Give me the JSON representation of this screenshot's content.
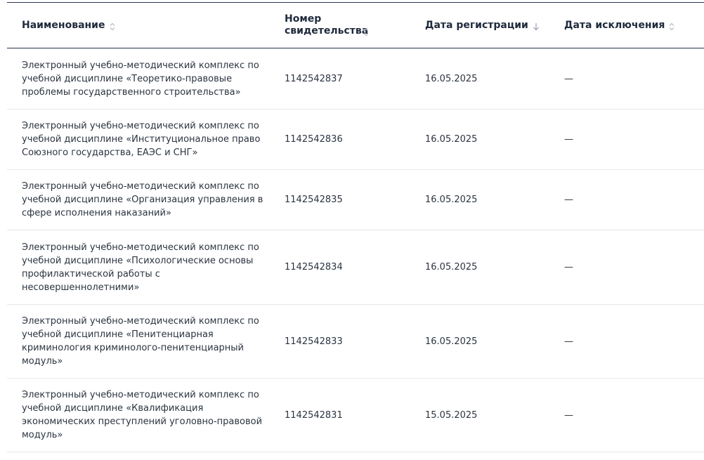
{
  "table": {
    "columns": [
      {
        "label": "Наименование",
        "sort": "none"
      },
      {
        "label": "Номер свидетельства",
        "sort": "none"
      },
      {
        "label": "Дата регистрации",
        "sort": "desc"
      },
      {
        "label": "Дата исключения",
        "sort": "none"
      }
    ],
    "rows": [
      {
        "name": "Электронный учебно-методический комплекс по учебной дисциплине «Теоретико-правовые проблемы государственного строительства»",
        "number": "1142542837",
        "reg_date": "16.05.2025",
        "excl_date": "—"
      },
      {
        "name": "Электронный учебно-методический комплекс по учебной дисциплине «Институциональное право Союзного государства, ЕАЭС и СНГ»",
        "number": "1142542836",
        "reg_date": "16.05.2025",
        "excl_date": "—"
      },
      {
        "name": "Электронный учебно-методический комплекс по учебной дисциплине «Организация управления в сфере исполнения наказаний»",
        "number": "1142542835",
        "reg_date": "16.05.2025",
        "excl_date": "—"
      },
      {
        "name": "Электронный учебно-методический комплекс по учебной дисциплине «Психологические основы профилактической работы с несовершеннолетними»",
        "number": "1142542834",
        "reg_date": "16.05.2025",
        "excl_date": "—"
      },
      {
        "name": "Электронный учебно-методический комплекс по учебной дисциплине «Пенитенциарная криминология криминолого-пенитенциарный модуль»",
        "number": "1142542833",
        "reg_date": "16.05.2025",
        "excl_date": "—"
      },
      {
        "name": "Электронный учебно-методический комплекс по учебной дисциплине «Квалификация экономических преступлений уголовно-правовой модуль»",
        "number": "1142542831",
        "reg_date": "15.05.2025",
        "excl_date": "—"
      }
    ]
  },
  "colors": {
    "header_rule": "#2b3550",
    "row_divider": "#e5e7ea",
    "text": "#2b3440",
    "sort_icon": "#b3b8c2"
  }
}
